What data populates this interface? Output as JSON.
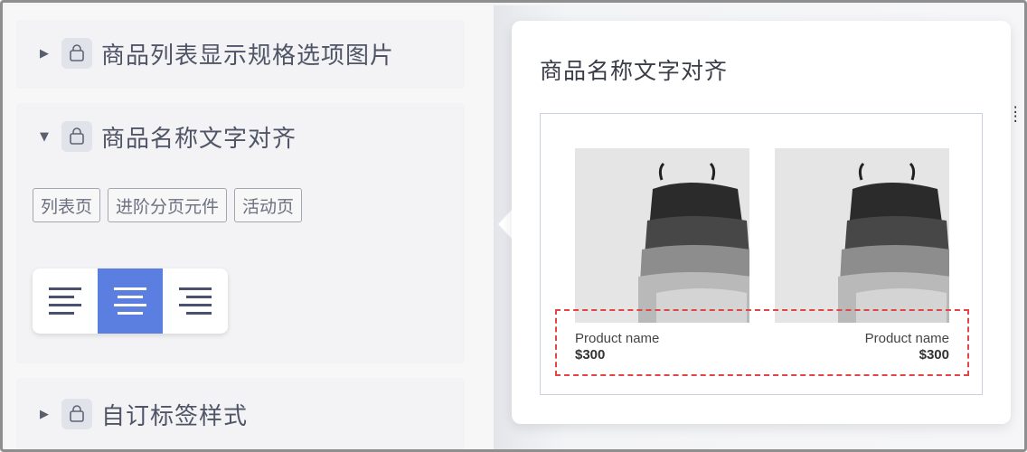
{
  "sections": [
    {
      "title": "商品列表显示规格选项图片",
      "expanded": false,
      "icon": "shopping-bag-icon"
    },
    {
      "title": "商品名称文字对齐",
      "expanded": true,
      "icon": "shopping-bag-icon"
    },
    {
      "title": "自订标签样式",
      "expanded": false,
      "icon": "shopping-bag-icon"
    }
  ],
  "tags": [
    "列表页",
    "进阶分页元件",
    "活动页"
  ],
  "alignment": {
    "options": [
      "align-left-icon",
      "align-center-icon",
      "align-right-icon"
    ],
    "selected": "center",
    "active_color": "#5b7fe0"
  },
  "popover": {
    "title": "商品名称文字对齐",
    "products": [
      {
        "name": "Product name",
        "price": "$300",
        "align": "left"
      },
      {
        "name": "Product name",
        "price": "$300",
        "align": "right"
      }
    ],
    "highlight_color": "#e04646"
  }
}
